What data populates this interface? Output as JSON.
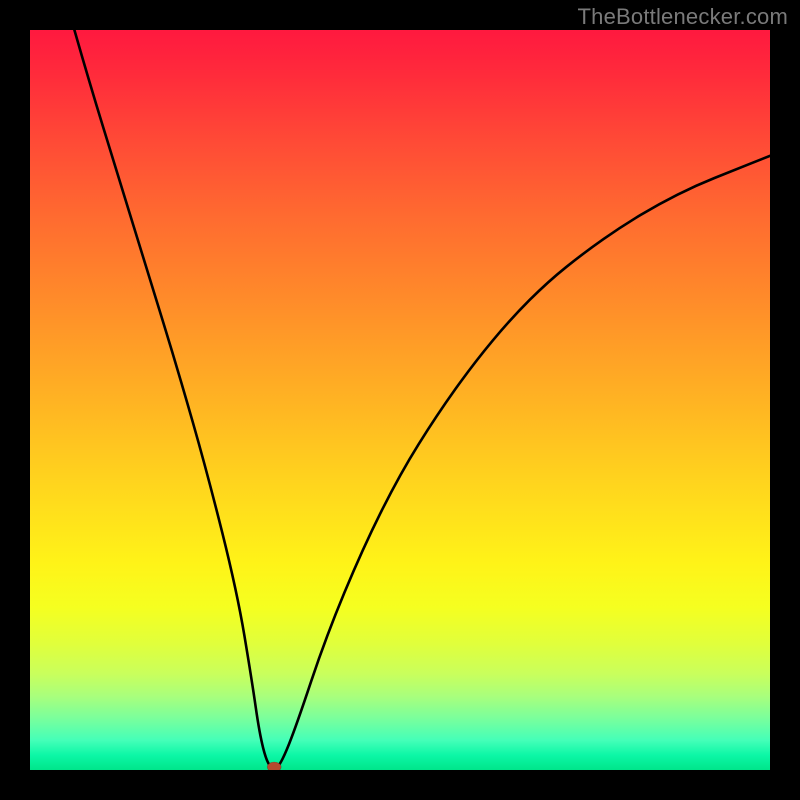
{
  "watermark": "TheBottlenecker.com",
  "chart_data": {
    "type": "line",
    "title": "",
    "xlabel": "",
    "ylabel": "",
    "xlim": [
      0,
      100
    ],
    "ylim": [
      0,
      100
    ],
    "x": [
      6,
      8,
      12,
      16,
      20,
      24,
      28,
      30,
      31,
      32,
      33,
      34,
      36,
      40,
      45,
      50,
      55,
      60,
      65,
      70,
      75,
      80,
      85,
      90,
      95,
      100
    ],
    "y": [
      100,
      93,
      80,
      67,
      54,
      40,
      24,
      12,
      5,
      1,
      0,
      1,
      6,
      18,
      30,
      40,
      48,
      55,
      61,
      66,
      70,
      73.5,
      76.5,
      79,
      81,
      83
    ],
    "minimum_point": {
      "x": 33,
      "y": 0
    },
    "colors": {
      "top": "#ff193f",
      "mid": "#ffd11e",
      "bottom": "#00e58a",
      "curve": "#000000",
      "dot": "#b5492e",
      "frame": "#000000"
    }
  }
}
